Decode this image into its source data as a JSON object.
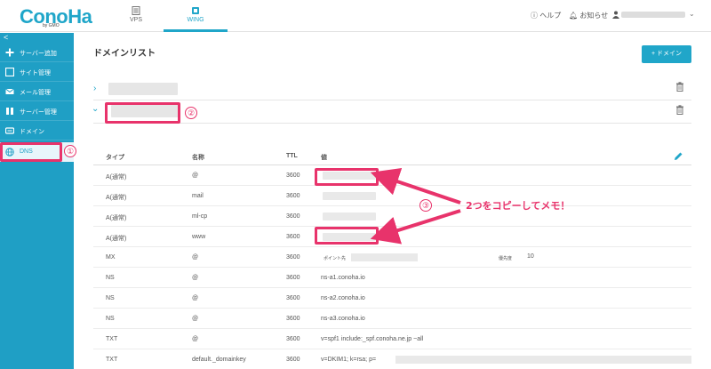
{
  "header": {
    "logo": "ConoHa",
    "logo_sub": "by GMO",
    "tabs": [
      {
        "label": "VPS",
        "icon": "server-icon"
      },
      {
        "label": "WING",
        "icon": "wing-icon"
      }
    ],
    "help_label": "ヘルプ",
    "notice_label": "お知らせ"
  },
  "sidebar": {
    "collapse": "<",
    "items": [
      {
        "label": "サーバー追加",
        "icon": "plus-icon"
      },
      {
        "label": "サイト管理",
        "icon": "site-icon"
      },
      {
        "label": "メール管理",
        "icon": "mail-icon"
      },
      {
        "label": "サーバー管理",
        "icon": "server-manage-icon"
      },
      {
        "label": "ドメイン",
        "icon": "domain-icon"
      },
      {
        "label": "DNS",
        "icon": "globe-icon"
      }
    ]
  },
  "main": {
    "title": "ドメインリスト",
    "add_domain_button": "+ ドメイン",
    "table": {
      "headers": [
        "タイプ",
        "名称",
        "TTL",
        "値"
      ],
      "rows": [
        {
          "type": "A(通常)",
          "name": "@",
          "ttl": "3600",
          "value": ""
        },
        {
          "type": "A(通常)",
          "name": "mail",
          "ttl": "3600",
          "value": ""
        },
        {
          "type": "A(通常)",
          "name": "ml-cp",
          "ttl": "3600",
          "value": ""
        },
        {
          "type": "A(通常)",
          "name": "www",
          "ttl": "3600",
          "value": ""
        },
        {
          "type": "MX",
          "name": "@",
          "ttl": "3600",
          "value": ""
        },
        {
          "type": "NS",
          "name": "@",
          "ttl": "3600",
          "value": "ns-a1.conoha.io"
        },
        {
          "type": "NS",
          "name": "@",
          "ttl": "3600",
          "value": "ns-a2.conoha.io"
        },
        {
          "type": "NS",
          "name": "@",
          "ttl": "3600",
          "value": "ns-a3.conoha.io"
        },
        {
          "type": "TXT",
          "name": "@",
          "ttl": "3600",
          "value": "v=spf1 include:_spf.conoha.ne.jp ~all"
        },
        {
          "type": "TXT",
          "name": "default._domainkey",
          "ttl": "3600",
          "value": "v=DKIM1; k=rsa; p="
        }
      ],
      "mx_target_label": "ポイント先",
      "mx_priority_label": "優先度",
      "mx_priority": "10"
    }
  },
  "annotations": {
    "step1": "①",
    "step2": "②",
    "step3": "③",
    "callout": "2つをコピーしてメモ！",
    "highlight_color": "#e8336b"
  },
  "colors": {
    "brand": "#20a6c9",
    "sidebar": "#1f9fc5"
  }
}
